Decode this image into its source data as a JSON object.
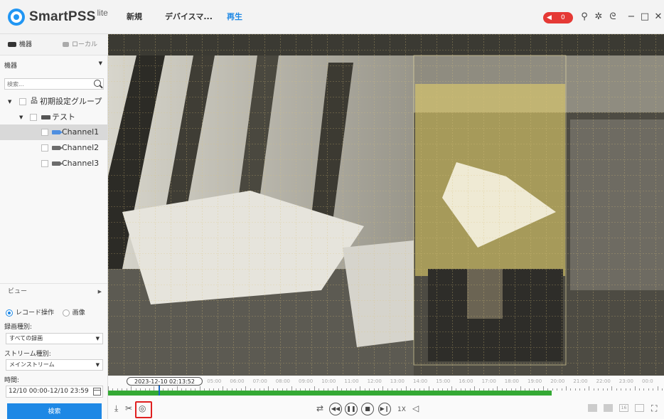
{
  "app": {
    "name": "SmartPSS",
    "suffix": "lite",
    "menu": [
      "新規",
      "デバイスマ...",
      "再生"
    ],
    "active_menu": "再生",
    "alarm_count": "0",
    "accent_color": "#1e88e5",
    "alarm_color": "#e53935"
  },
  "toolbar_icons": [
    "user-icon",
    "gear-icon",
    "lock-icon",
    "minimize-icon",
    "maximize-icon",
    "close-icon"
  ],
  "sidebar": {
    "tabs": [
      {
        "label": "機器",
        "icon": "device-icon"
      },
      {
        "label": "ローカル",
        "icon": "monitor-icon"
      }
    ],
    "device_select": "機器",
    "search_placeholder": "検索...",
    "tree": {
      "group": "初期設定グループ",
      "device": "テスト",
      "channels": [
        "Channel1",
        "Channel2",
        "Channel3"
      ],
      "selected": "Channel1"
    },
    "view_label": "ビュー",
    "mode": {
      "record_op": "レコード操作",
      "image": "画像",
      "selected": "レコード操作"
    },
    "record_type_label": "録画種別:",
    "record_type_value": "すべての録画",
    "stream_type_label": "ストリーム種別:",
    "stream_type_value": "メインストリーム",
    "time_label": "時間:",
    "time_value": "12/10 00:00-12/10 23:59",
    "search_button": "検索"
  },
  "timeline": {
    "current": "2023-12-10 02:13:52",
    "hours": [
      "04:00",
      "05:00",
      "06:00",
      "07:00",
      "08:00",
      "09:00",
      "10:00",
      "11:00",
      "12:00",
      "13:00",
      "14:00",
      "15:00",
      "16:00",
      "17:00",
      "18:00",
      "19:00",
      "20:00",
      "21:00",
      "22:00",
      "23:00",
      "00:0"
    ],
    "recorded_color": "#34a934"
  },
  "controls": {
    "speed": "1X",
    "layout_16": "16"
  }
}
